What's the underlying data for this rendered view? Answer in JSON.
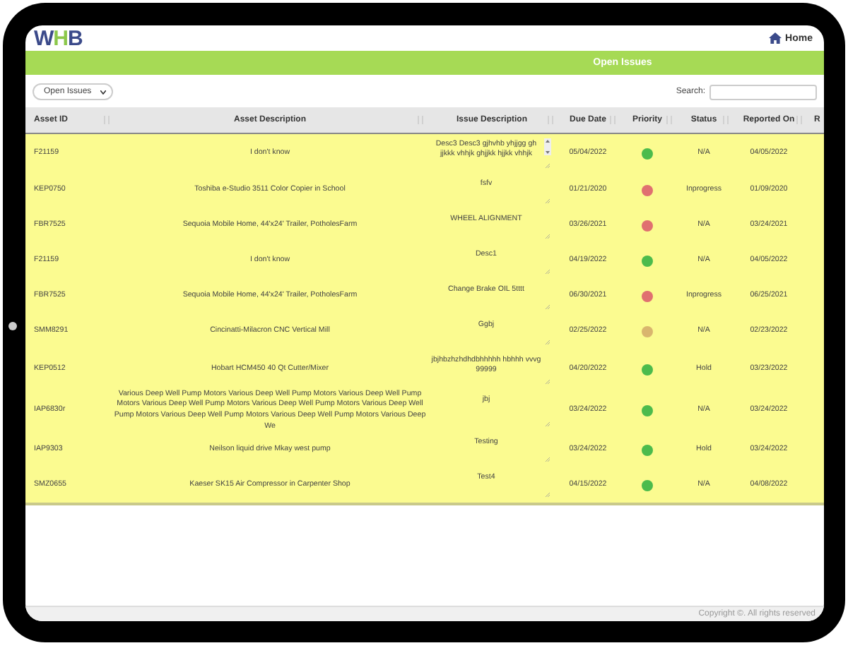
{
  "header": {
    "logo": [
      {
        "text": "W",
        "accent": false
      },
      {
        "text": "H",
        "accent": true
      },
      {
        "text": "B",
        "accent": false
      }
    ],
    "home_link": "Home"
  },
  "banner": {
    "title": "Open Issues"
  },
  "filter": {
    "value": "Open Issues"
  },
  "search": {
    "label": "Search:"
  },
  "table": {
    "columns": [
      "Asset ID",
      "Asset Description",
      "Issue Description",
      "Due Date",
      "Priority",
      "Status",
      "Reported On",
      "R"
    ],
    "rows": [
      {
        "asset_id": "F21159",
        "asset_description": "I don't know",
        "issue_description": "Desc3  Desc3 gjhvhb yhjjgg gh jjkkk vhhjk ghjjkk hjjkk vhhjk",
        "scrollable": true,
        "due_date": "05/04/2022",
        "color": "#4cbb4c",
        "status": "N/A",
        "reported_on": "04/05/2022"
      },
      {
        "asset_id": "KEP0750",
        "asset_description": "Toshiba e-Studio 3511 Color Copier in School",
        "issue_description": "fsfv",
        "scrollable": false,
        "due_date": "01/21/2020",
        "color": "#e07070",
        "status": "Inprogress",
        "reported_on": "01/09/2020"
      },
      {
        "asset_id": "FBR7525",
        "asset_description": "Sequoia Mobile Home, 44'x24' Trailer, PotholesFarm",
        "issue_description": "WHEEL ALIGNMENT",
        "scrollable": false,
        "due_date": "03/26/2021",
        "color": "#e07070",
        "status": "N/A",
        "reported_on": "03/24/2021"
      },
      {
        "asset_id": "F21159",
        "asset_description": "I don't know",
        "issue_description": "Desc1",
        "scrollable": false,
        "due_date": "04/19/2022",
        "color": "#4cbb4c",
        "status": "N/A",
        "reported_on": "04/05/2022"
      },
      {
        "asset_id": "FBR7525",
        "asset_description": "Sequoia Mobile Home, 44'x24' Trailer, PotholesFarm",
        "issue_description": "Change Brake OIL 5tttt",
        "scrollable": false,
        "due_date": "06/30/2021",
        "color": "#e07070",
        "status": "Inprogress",
        "reported_on": "06/25/2021"
      },
      {
        "asset_id": "SMM8291",
        "asset_description": "Cincinatti-Milacron CNC Vertical Mill",
        "issue_description": "Ggbj",
        "scrollable": false,
        "due_date": "02/25/2022",
        "color": "#d9b56e",
        "status": "N/A",
        "reported_on": "02/23/2022"
      },
      {
        "asset_id": "KEP0512",
        "asset_description": "Hobart HCM450 40 Qt Cutter/Mixer",
        "issue_description": "jbjhbzhzhdhdbhhhhh hbhhh vvvg 99999",
        "scrollable": false,
        "due_date": "04/20/2022",
        "color": "#4cbb4c",
        "status": "Hold",
        "reported_on": "03/23/2022"
      },
      {
        "asset_id": "IAP6830r",
        "asset_description": "Various Deep Well Pump Motors Various Deep Well Pump Motors Various Deep Well Pump Motors Various Deep Well Pump Motors Various Deep Well Pump Motors Various Deep Well Pump Motors Various Deep Well Pump Motors Various Deep Well Pump Motors Various Deep We",
        "scrollable": false,
        "issue_description": "jbj",
        "due_date": "03/24/2022",
        "color": "#4cbb4c",
        "status": "N/A",
        "reported_on": "03/24/2022"
      },
      {
        "asset_id": "IAP9303",
        "asset_description": "Neilson liquid drive Mkay west pump",
        "issue_description": "Testing",
        "scrollable": false,
        "due_date": "03/24/2022",
        "color": "#4cbb4c",
        "status": "Hold",
        "reported_on": "03/24/2022"
      },
      {
        "asset_id": "SMZ0655",
        "asset_description": "Kaeser SK15 Air Compressor in Carpenter Shop",
        "issue_description": "Test4",
        "scrollable": false,
        "due_date": "04/15/2022",
        "color": "#4cbb4c",
        "status": "N/A",
        "reported_on": "04/08/2022"
      }
    ]
  },
  "footer": {
    "copyright": "Copyright ©. All rights reserved"
  }
}
